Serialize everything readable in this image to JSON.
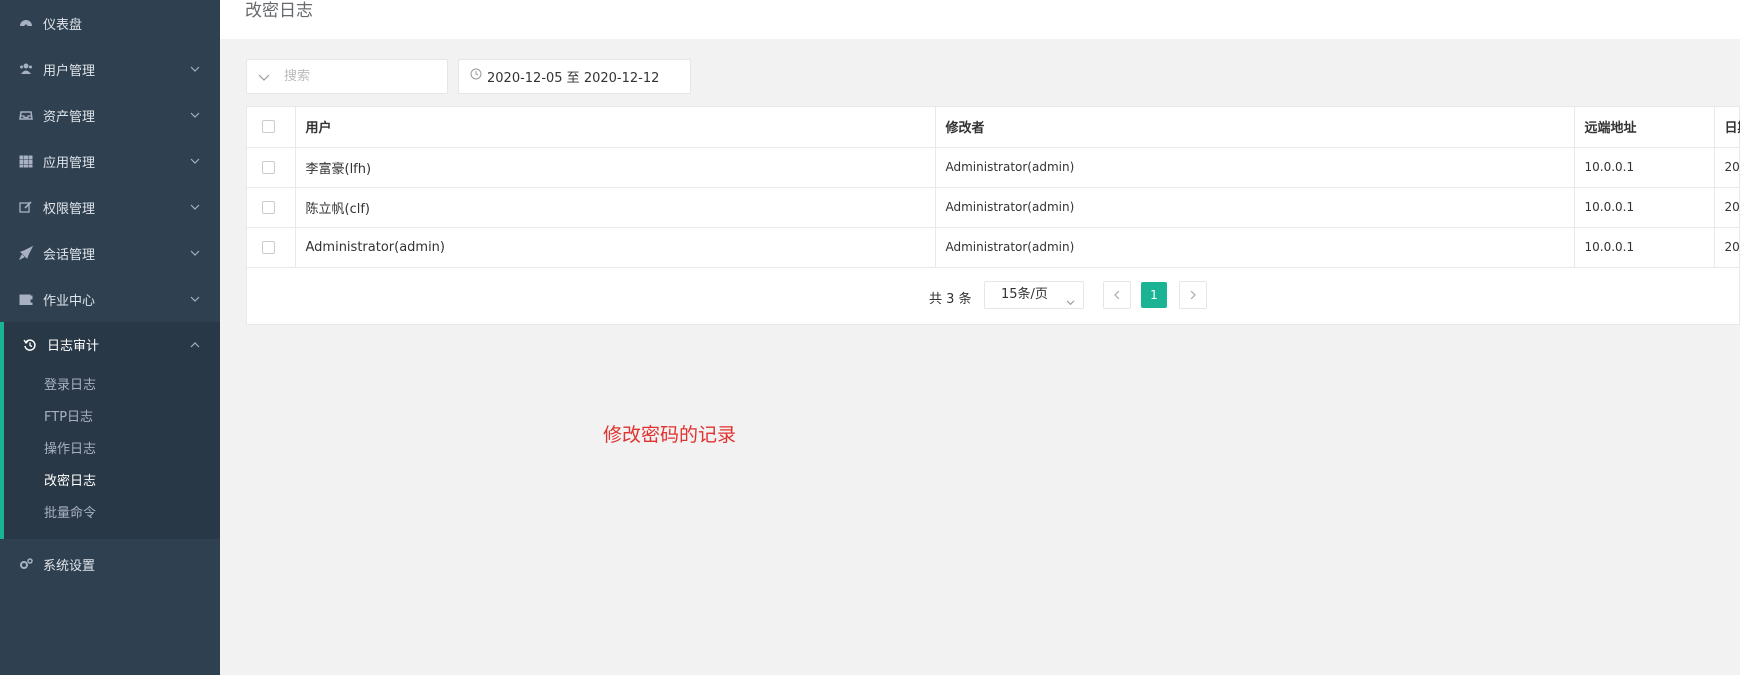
{
  "sidebar": {
    "items": [
      {
        "label": "仪表盘",
        "icon": "dashboard-icon"
      },
      {
        "label": "用户管理",
        "icon": "users-icon"
      },
      {
        "label": "资产管理",
        "icon": "inbox-icon"
      },
      {
        "label": "应用管理",
        "icon": "grid-icon"
      },
      {
        "label": "权限管理",
        "icon": "edit-icon"
      },
      {
        "label": "会话管理",
        "icon": "rocket-icon"
      },
      {
        "label": "作业中心",
        "icon": "coffee-icon"
      }
    ],
    "active_group": {
      "label": "日志审计",
      "icon": "history-icon",
      "sub_items": [
        "登录日志",
        "FTP日志",
        "操作日志",
        "改密日志",
        "批量命令"
      ],
      "active_sub": "改密日志"
    },
    "settings": {
      "label": "系统设置",
      "icon": "cogs-icon"
    }
  },
  "header": {
    "title": "改密日志"
  },
  "filters": {
    "search_placeholder": "搜索",
    "date_range": "2020-12-05 至 2020-12-12"
  },
  "table": {
    "columns": [
      "用户",
      "修改者",
      "远端地址",
      "日期"
    ],
    "rows": [
      {
        "user": "李富豪(lfh)",
        "modifier": "Administrator(admin)",
        "remote": "10.0.0.1",
        "date": "20"
      },
      {
        "user": "陈立帆(clf)",
        "modifier": "Administrator(admin)",
        "remote": "10.0.0.1",
        "date": "20"
      },
      {
        "user": "Administrator(admin)",
        "modifier": "Administrator(admin)",
        "remote": "10.0.0.1",
        "date": "20"
      }
    ]
  },
  "pagination": {
    "total": "共 3 条",
    "page_size": "15条/页",
    "current_page": "1"
  },
  "annotation": "修改密码的记录",
  "colors": {
    "sidebar_bg": "#2f4050",
    "accent": "#1ab394",
    "annotation": "#e0322f"
  }
}
